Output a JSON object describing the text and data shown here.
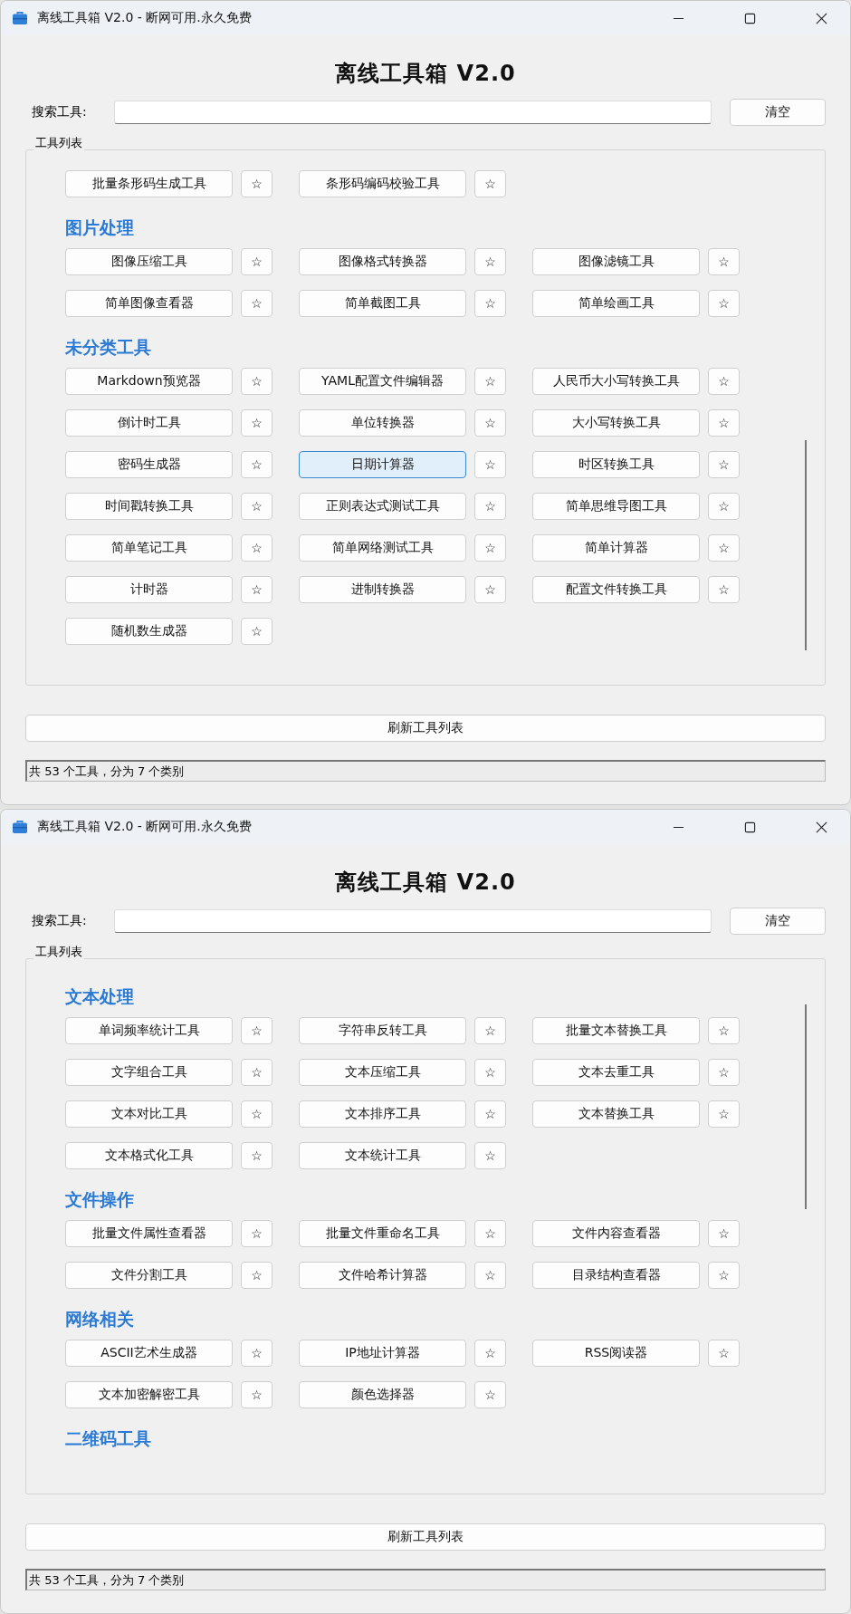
{
  "windows": [
    {
      "title": "离线工具箱 V2.0 - 断网可用.永久免费",
      "heading": "离线工具箱 V2.0",
      "search_label": "搜索工具:",
      "clear_button": "清空",
      "group_title": "工具列表",
      "sections": [
        {
          "tools": [
            {
              "label": "批量条形码生成工具",
              "star": "☆",
              "selected": false
            },
            {
              "label": "条形码编码校验工具",
              "star": "☆",
              "selected": false
            }
          ]
        },
        {
          "title": "图片处理",
          "tools": [
            {
              "label": "图像压缩工具",
              "star": "☆",
              "selected": false
            },
            {
              "label": "图像格式转换器",
              "star": "☆",
              "selected": false
            },
            {
              "label": "图像滤镜工具",
              "star": "☆",
              "selected": false
            },
            {
              "label": "简单图像查看器",
              "star": "☆",
              "selected": false
            },
            {
              "label": "简单截图工具",
              "star": "☆",
              "selected": false
            },
            {
              "label": "简单绘画工具",
              "star": "☆",
              "selected": false
            }
          ]
        },
        {
          "title": "未分类工具",
          "tools": [
            {
              "label": "Markdown预览器",
              "star": "☆",
              "selected": false
            },
            {
              "label": "YAML配置文件编辑器",
              "star": "☆",
              "selected": false
            },
            {
              "label": "人民币大小写转换工具",
              "star": "☆",
              "selected": false
            },
            {
              "label": "倒计时工具",
              "star": "☆",
              "selected": false
            },
            {
              "label": "单位转换器",
              "star": "☆",
              "selected": false
            },
            {
              "label": "大小写转换工具",
              "star": "☆",
              "selected": false
            },
            {
              "label": "密码生成器",
              "star": "☆",
              "selected": false
            },
            {
              "label": "日期计算器",
              "star": "☆",
              "selected": true
            },
            {
              "label": "时区转换工具",
              "star": "☆",
              "selected": false
            },
            {
              "label": "时间戳转换工具",
              "star": "☆",
              "selected": false
            },
            {
              "label": "正则表达式测试工具",
              "star": "☆",
              "selected": false
            },
            {
              "label": "简单思维导图工具",
              "star": "☆",
              "selected": false
            },
            {
              "label": "简单笔记工具",
              "star": "☆",
              "selected": false
            },
            {
              "label": "简单网络测试工具",
              "star": "☆",
              "selected": false
            },
            {
              "label": "简单计算器",
              "star": "☆",
              "selected": false
            },
            {
              "label": "计时器",
              "star": "☆",
              "selected": false
            },
            {
              "label": "进制转换器",
              "star": "☆",
              "selected": false
            },
            {
              "label": "配置文件转换工具",
              "star": "☆",
              "selected": false
            },
            {
              "label": "随机数生成器",
              "star": "☆",
              "selected": false
            }
          ]
        }
      ],
      "refresh_button": "刷新工具列表",
      "status": "共 53 个工具，分为 7 个类别"
    },
    {
      "title": "离线工具箱 V2.0 - 断网可用.永久免费",
      "heading": "离线工具箱 V2.0",
      "search_label": "搜索工具:",
      "clear_button": "清空",
      "group_title": "工具列表",
      "sections": [
        {
          "title": "文本处理",
          "tools": [
            {
              "label": "单词频率统计工具",
              "star": "☆",
              "selected": false
            },
            {
              "label": "字符串反转工具",
              "star": "☆",
              "selected": false
            },
            {
              "label": "批量文本替换工具",
              "star": "☆",
              "selected": false
            },
            {
              "label": "文字组合工具",
              "star": "☆",
              "selected": false
            },
            {
              "label": "文本压缩工具",
              "star": "☆",
              "selected": false
            },
            {
              "label": "文本去重工具",
              "star": "☆",
              "selected": false
            },
            {
              "label": "文本对比工具",
              "star": "☆",
              "selected": false
            },
            {
              "label": "文本排序工具",
              "star": "☆",
              "selected": false
            },
            {
              "label": "文本替换工具",
              "star": "☆",
              "selected": false
            },
            {
              "label": "文本格式化工具",
              "star": "☆",
              "selected": false
            },
            {
              "label": "文本统计工具",
              "star": "☆",
              "selected": false
            }
          ]
        },
        {
          "title": "文件操作",
          "tools": [
            {
              "label": "批量文件属性查看器",
              "star": "☆",
              "selected": false
            },
            {
              "label": "批量文件重命名工具",
              "star": "☆",
              "selected": false
            },
            {
              "label": "文件内容查看器",
              "star": "☆",
              "selected": false
            },
            {
              "label": "文件分割工具",
              "star": "☆",
              "selected": false
            },
            {
              "label": "文件哈希计算器",
              "star": "☆",
              "selected": false
            },
            {
              "label": "目录结构查看器",
              "star": "☆",
              "selected": false
            }
          ]
        },
        {
          "title": "网络相关",
          "tools": [
            {
              "label": "ASCII艺术生成器",
              "star": "☆",
              "selected": false
            },
            {
              "label": "IP地址计算器",
              "star": "☆",
              "selected": false
            },
            {
              "label": "RSS阅读器",
              "star": "☆",
              "selected": false
            },
            {
              "label": "文本加密解密工具",
              "star": "☆",
              "selected": false
            },
            {
              "label": "颜色选择器",
              "star": "☆",
              "selected": false
            }
          ]
        },
        {
          "title": "二维码工具"
        }
      ],
      "refresh_button": "刷新工具列表",
      "status": "共 53 个工具，分为 7 个类别"
    }
  ]
}
